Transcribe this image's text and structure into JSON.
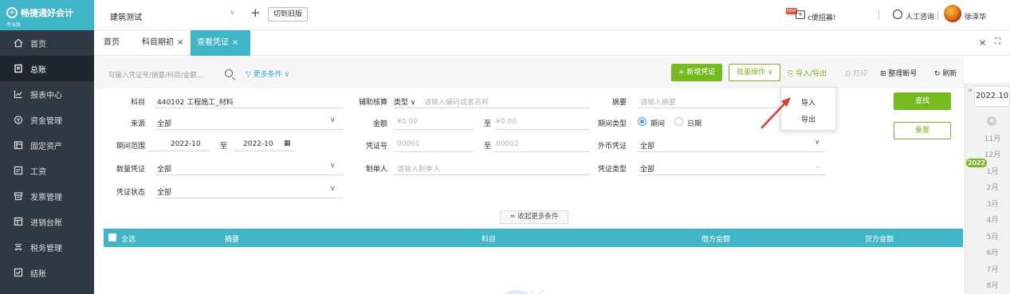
{
  "app": {
    "logo_name": "畅捷通好会计",
    "logo_sub": "专业版",
    "logo_mark": "+"
  },
  "sidebar": {
    "items": [
      {
        "label": "首页",
        "icon": "home-icon"
      },
      {
        "label": "总账",
        "icon": "ledger-icon",
        "active": true
      },
      {
        "label": "报表中心",
        "icon": "chart-icon"
      },
      {
        "label": "资金管理",
        "icon": "money-icon"
      },
      {
        "label": "固定资产",
        "icon": "asset-icon"
      },
      {
        "label": "工资",
        "icon": "salary-icon"
      },
      {
        "label": "发票管理",
        "icon": "invoice-icon"
      },
      {
        "label": "进销台账",
        "icon": "inventory-icon"
      },
      {
        "label": "税务管理",
        "icon": "tax-icon"
      },
      {
        "label": "结账",
        "icon": "close-books-icon"
      }
    ]
  },
  "header": {
    "company": "建筑测试",
    "plus": "+",
    "switch_label": "切到旧版",
    "new_badge": "NEW",
    "recruit": "c便招募!",
    "service": "人工咨询",
    "username": "徐泽华"
  },
  "tabs": [
    {
      "label": "首页",
      "closable": false
    },
    {
      "label": "科目期初",
      "closable": true
    },
    {
      "label": "查看凭证",
      "closable": true,
      "active": true
    }
  ],
  "tab_tools": {
    "close_all": "×",
    "expand": "⛶"
  },
  "toolbar": {
    "search_placeholder": "可输入凭证号/摘要/科目/金额...",
    "more_filter": "更多条件",
    "new_voucher": "+ 新增凭证",
    "batch": "批量操作",
    "import_export": "导入/导出",
    "print": "打印",
    "reorganize": "整理断号",
    "refresh": "刷新"
  },
  "filters": {
    "subject_label": "科目",
    "subject_value": "440102 工程施工_材料",
    "source_label": "来源",
    "source_value": "全部",
    "period_label": "期间范围",
    "period_from": "2022-10",
    "period_to_word": "至",
    "period_to": "2022-10",
    "qty_label": "数量凭证",
    "qty_value": "全部",
    "status_label": "凭证状态",
    "status_value": "全部",
    "aux_label": "辅助核算",
    "aux_type": "类型",
    "aux_placeholder": "请输入编码或者名称",
    "amount_label": "金额",
    "amount_from_ph": "¥0.00",
    "amount_to_word": "至",
    "amount_to_ph": "¥0.00",
    "voucher_no_label": "凭证号",
    "voucher_no_from_ph": "00001",
    "voucher_no_to_word": "至",
    "voucher_no_to_ph": "00002",
    "maker_label": "制单人",
    "maker_placeholder": "请输入制单人",
    "summary_label": "摘要",
    "summary_placeholder": "请输入摘要",
    "period_type_label": "期间类型",
    "period_type_opt1": "期间",
    "period_type_opt2": "日期",
    "period_type_selected": "期间",
    "fx_label": "外币凭证",
    "fx_value": "全部",
    "vtype_label": "凭证类型",
    "vtype_value": "全部",
    "query": "查找",
    "reset": "重置",
    "collapse": "收起更多条件"
  },
  "table": {
    "headers": [
      "全选",
      "摘要",
      "科目",
      "借方金额",
      "贷方金额"
    ]
  },
  "dropdown": {
    "import": "导入",
    "export": "导出"
  },
  "rail": {
    "current": "2022.10",
    "year_badge": "2022",
    "months": [
      "11月",
      "12月",
      "1月",
      "2月",
      "3月",
      "4月",
      "5月",
      "6月",
      "7月",
      "8月"
    ]
  },
  "colors": {
    "sidebar_bg": "#2f3843",
    "brand_teal": "#3fb6c8",
    "accent_green": "#76bc21",
    "link_blue": "#3fa7d6",
    "annotation_red": "#e8362b"
  }
}
